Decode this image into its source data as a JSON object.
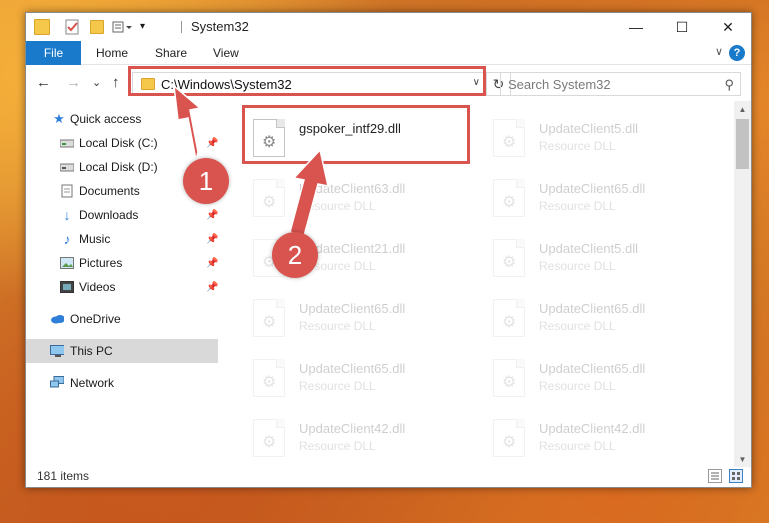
{
  "window": {
    "title": "System32",
    "minimize_glyph": "—",
    "maximize_glyph": "☐",
    "close_glyph": "✕"
  },
  "ribbon": {
    "tabs": [
      "File",
      "Home",
      "Share",
      "View"
    ],
    "collapse_glyph": "∨",
    "help_glyph": "?"
  },
  "nav": {
    "back_glyph": "←",
    "forward_glyph": "→",
    "recent_glyph": "⌄",
    "up_glyph": "↑",
    "address": "C:\\Windows\\System32",
    "address_chevron": "∨",
    "refresh_glyph": "↻",
    "search_placeholder": "Search System32",
    "search_glyph": "⚲"
  },
  "sidebar": {
    "items": [
      {
        "label": "Quick access",
        "icon": "star-icon",
        "pinned": false
      },
      {
        "label": "Local Disk (C:)",
        "icon": "drive-icon",
        "pinned": true
      },
      {
        "label": "Local Disk (D:)",
        "icon": "drive-icon",
        "pinned": false
      },
      {
        "label": "Documents",
        "icon": "documents-icon",
        "pinned": true
      },
      {
        "label": "Downloads",
        "icon": "downloads-icon",
        "pinned": true
      },
      {
        "label": "Music",
        "icon": "music-icon",
        "pinned": true
      },
      {
        "label": "Pictures",
        "icon": "pictures-icon",
        "pinned": true
      },
      {
        "label": "Videos",
        "icon": "videos-icon",
        "pinned": true
      },
      {
        "label": "OneDrive",
        "icon": "cloud-icon",
        "pinned": false
      },
      {
        "label": "This PC",
        "icon": "monitor-icon",
        "pinned": false,
        "selected": true
      },
      {
        "label": "Network",
        "icon": "network-icon",
        "pinned": false
      }
    ],
    "pin_glyph": "📌"
  },
  "files": [
    {
      "name": "gspoker_intf29.dll",
      "type": "",
      "highlighted": true
    },
    {
      "name": "UpdateClient5.dll",
      "type": "Resource DLL"
    },
    {
      "name": "UpdateClient63.dll",
      "type": "Resource DLL"
    },
    {
      "name": "UpdateClient65.dll",
      "type": "Resource DLL"
    },
    {
      "name": "UpdateClient21.dll",
      "type": "Resource DLL"
    },
    {
      "name": "UpdateClient5.dll",
      "type": "Resource DLL"
    },
    {
      "name": "UpdateClient65.dll",
      "type": "Resource DLL"
    },
    {
      "name": "UpdateClient65.dll",
      "type": "Resource DLL"
    },
    {
      "name": "UpdateClient65.dll",
      "type": "Resource DLL"
    },
    {
      "name": "UpdateClient65.dll",
      "type": "Resource DLL"
    },
    {
      "name": "UpdateClient42.dll",
      "type": "Resource DLL"
    },
    {
      "name": "UpdateClient42.dll",
      "type": "Resource DLL"
    }
  ],
  "status": {
    "item_count": "181 items"
  },
  "callouts": [
    {
      "label": "1"
    },
    {
      "label": "2"
    }
  ],
  "colors": {
    "accent": "#1979ca",
    "highlight": "#d9534f",
    "selected_bg": "#d9d9d9"
  }
}
